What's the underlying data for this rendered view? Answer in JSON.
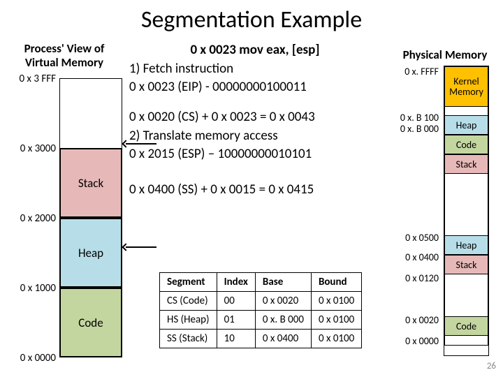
{
  "title": "Segmentation Example",
  "process_view_label": "Process' View of Virtual Memory",
  "physical_memory_label": "Physical Memory",
  "pv_addresses": {
    "a0": "0 x 3 FFF",
    "a1": "0 x 3000",
    "a2": "0 x 2000",
    "a3": "0 x 1000",
    "a4": "0 x 0000"
  },
  "pv_segments": {
    "stack": "Stack",
    "heap": "Heap",
    "code": "Code"
  },
  "pm_addresses": {
    "top": "0 x. FFFF",
    "b100": "0 x. B 100",
    "b000": "0 x. B 000",
    "a0500": "0 x 0500",
    "a0400": "0 x 0400",
    "a0120": "0 x 0120",
    "a0020": "0 x 0020",
    "a0000": "0 x 0000"
  },
  "pm_segments": {
    "kernel": "Kernel Memory",
    "heap": "Heap",
    "code": "Code",
    "stack": "Stack"
  },
  "center": {
    "instr": "0 x 0023 mov eax, [esp]",
    "l1": "1) Fetch instruction",
    "l2a": "0 x 0023 (EIP)  -  00000000100011",
    "l3": "0 x 0020 (CS) + 0 x 0023 = 0 x 0043",
    "l4": "2) Translate memory access",
    "l5": "0 x 2015 (ESP) – 10000000010101",
    "l6": "0 x 0400 (SS) + 0 x 0015 = 0 x 0415"
  },
  "table": {
    "h": {
      "seg": "Segment",
      "idx": "Index",
      "base": "Base",
      "bound": "Bound"
    },
    "r0": {
      "seg": "CS (Code)",
      "idx": "00",
      "base": "0 x 0020",
      "bound": "0 x 0100"
    },
    "r1": {
      "seg": "HS (Heap)",
      "idx": "01",
      "base": "0 x. B 000",
      "bound": "0 x 0100"
    },
    "r2": {
      "seg": "SS (Stack)",
      "idx": "10",
      "base": "0 x 0400",
      "bound": "0 x 0100"
    }
  },
  "page_number": "26"
}
